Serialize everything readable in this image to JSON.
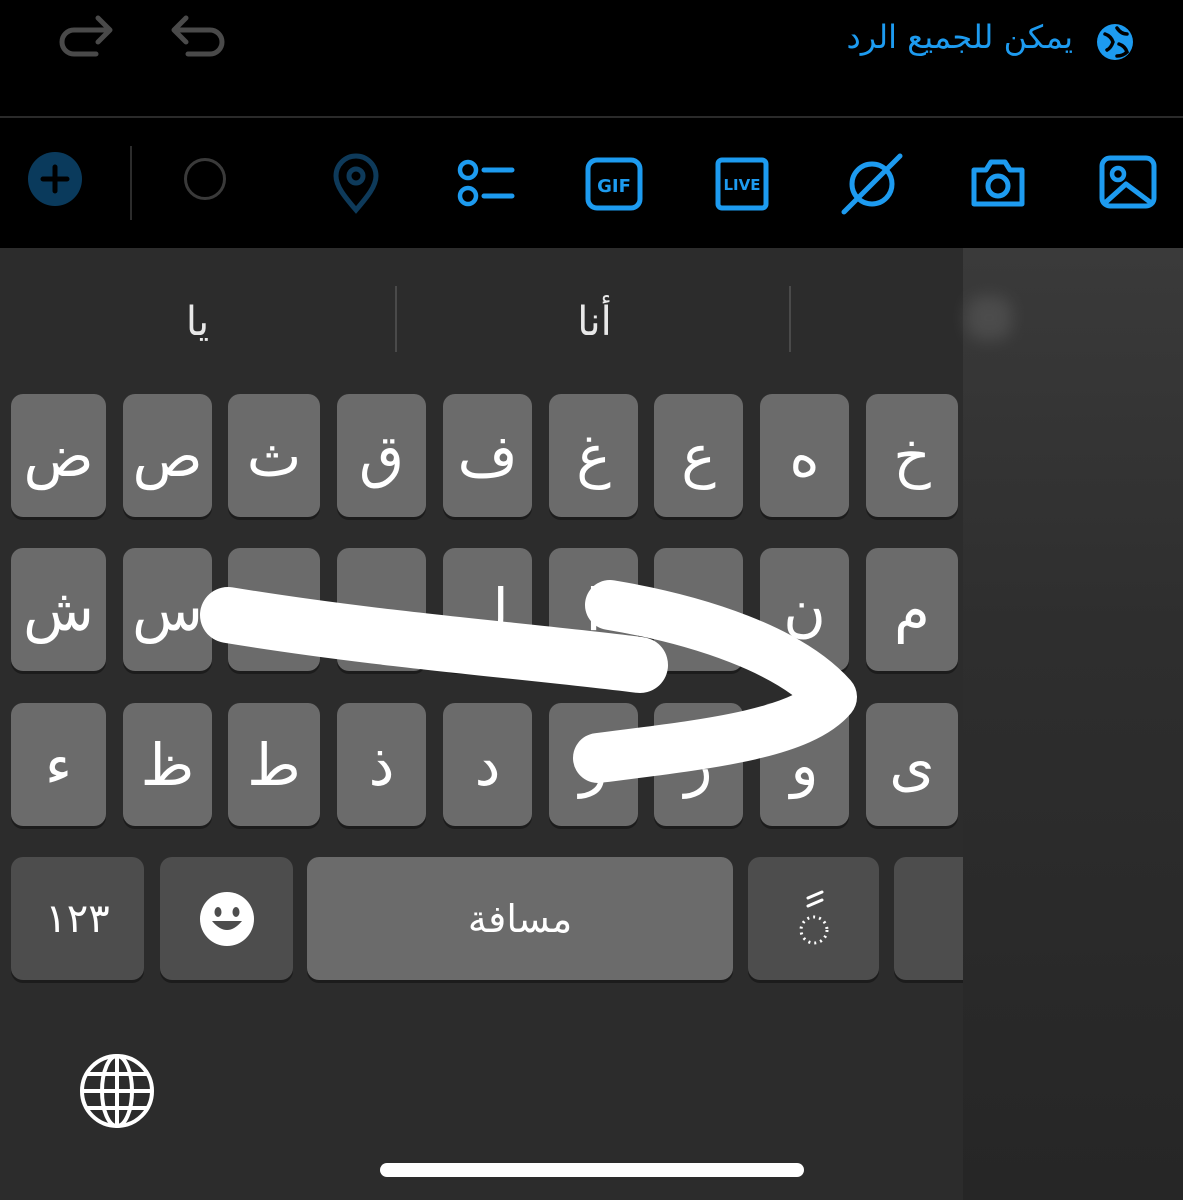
{
  "header": {
    "reply_scope_label": "يمكن للجميع الرد",
    "redo_icon": "redo-icon",
    "undo_icon": "undo-icon",
    "globe_icon": "globe-badge-icon"
  },
  "toolbar": {
    "icons": [
      "add-thread-icon",
      "char-counter-icon",
      "location-icon",
      "poll-icon",
      "gif-icon",
      "live-icon",
      "spaces-icon",
      "camera-icon",
      "image-icon"
    ],
    "gif_label": "GIF",
    "live_label": "LIVE",
    "accent": "#1d9bf0"
  },
  "suggestions": [
    "يا",
    "أنا",
    ""
  ],
  "keyboard": {
    "rows": [
      [
        "ض",
        "ص",
        "ث",
        "ق",
        "ف",
        "غ",
        "ع",
        "ه",
        "خ"
      ],
      [
        "ش",
        "س",
        "ي",
        "ب",
        "ل",
        "ا",
        "ت",
        "ن",
        "م"
      ],
      [
        "ء",
        "ظ",
        "ط",
        "ذ",
        "د",
        "ز",
        "ر",
        "و",
        "ى"
      ]
    ],
    "numbers_label": "١٢٣",
    "emoji_icon": "emoji-icon",
    "space_label": "مسافة",
    "diacritic_label": "ًً",
    "globe_icon": "globe-icon"
  },
  "swipe_gesture": "arrow-right"
}
